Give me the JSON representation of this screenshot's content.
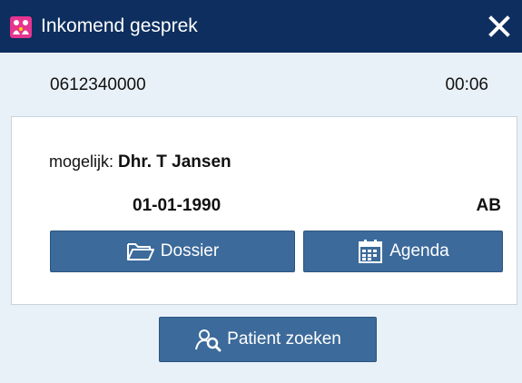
{
  "titlebar": {
    "title": "Inkomend gesprek",
    "accent_color": "#0d2e5e",
    "app_icon_color": "#e6358f",
    "app_icon": "app-logo-icon",
    "close_icon": "close-icon"
  },
  "call": {
    "phone_number": "0612340000",
    "duration": "00:06"
  },
  "match": {
    "possible_label": "mogelijk:",
    "patient_name": "Dhr. T Jansen",
    "birth_date": "01-01-1990",
    "initials": "AB"
  },
  "buttons": {
    "dossier_label": "Dossier",
    "dossier_icon": "folder-icon",
    "agenda_label": "Agenda",
    "agenda_icon": "calendar-icon",
    "search_label": "Patient zoeken",
    "search_icon": "patient-search-icon",
    "button_color": "#3c6a9a"
  }
}
